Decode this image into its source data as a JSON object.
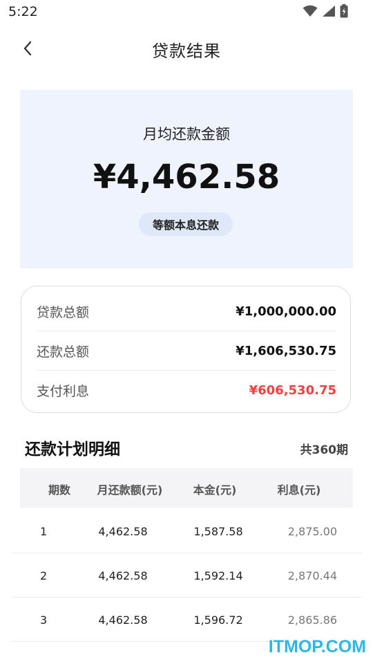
{
  "status_bar": {
    "time": "5:22",
    "icons": [
      "wifi-icon",
      "signal-icon",
      "battery-icon"
    ]
  },
  "header": {
    "back_icon": "chevron-left-icon",
    "title": "贷款结果"
  },
  "summary": {
    "label": "月均还款金额",
    "amount": "¥4,462.58",
    "method": "等额本息还款",
    "bg_color": "#eff3fe"
  },
  "totals": [
    {
      "label": "贷款总额",
      "value": "¥1,000,000.00"
    },
    {
      "label": "还款总额",
      "value": "¥1,606,530.75"
    },
    {
      "label": "支付利息",
      "value": "¥606,530.75",
      "color": "#f24040"
    }
  ],
  "schedule": {
    "title": "还款计划明细",
    "count": "共360期",
    "headers": [
      "期数",
      "月还款额(元)",
      "本金(元)",
      "利息(元)"
    ],
    "rows": [
      [
        "1",
        "4,462.58",
        "1,587.58",
        "2,875.00"
      ],
      [
        "2",
        "4,462.58",
        "1,592.14",
        "2,870.44"
      ],
      [
        "3",
        "4,462.58",
        "1,596.72",
        "2,865.86"
      ]
    ]
  },
  "watermark": "ITMOP.COM"
}
